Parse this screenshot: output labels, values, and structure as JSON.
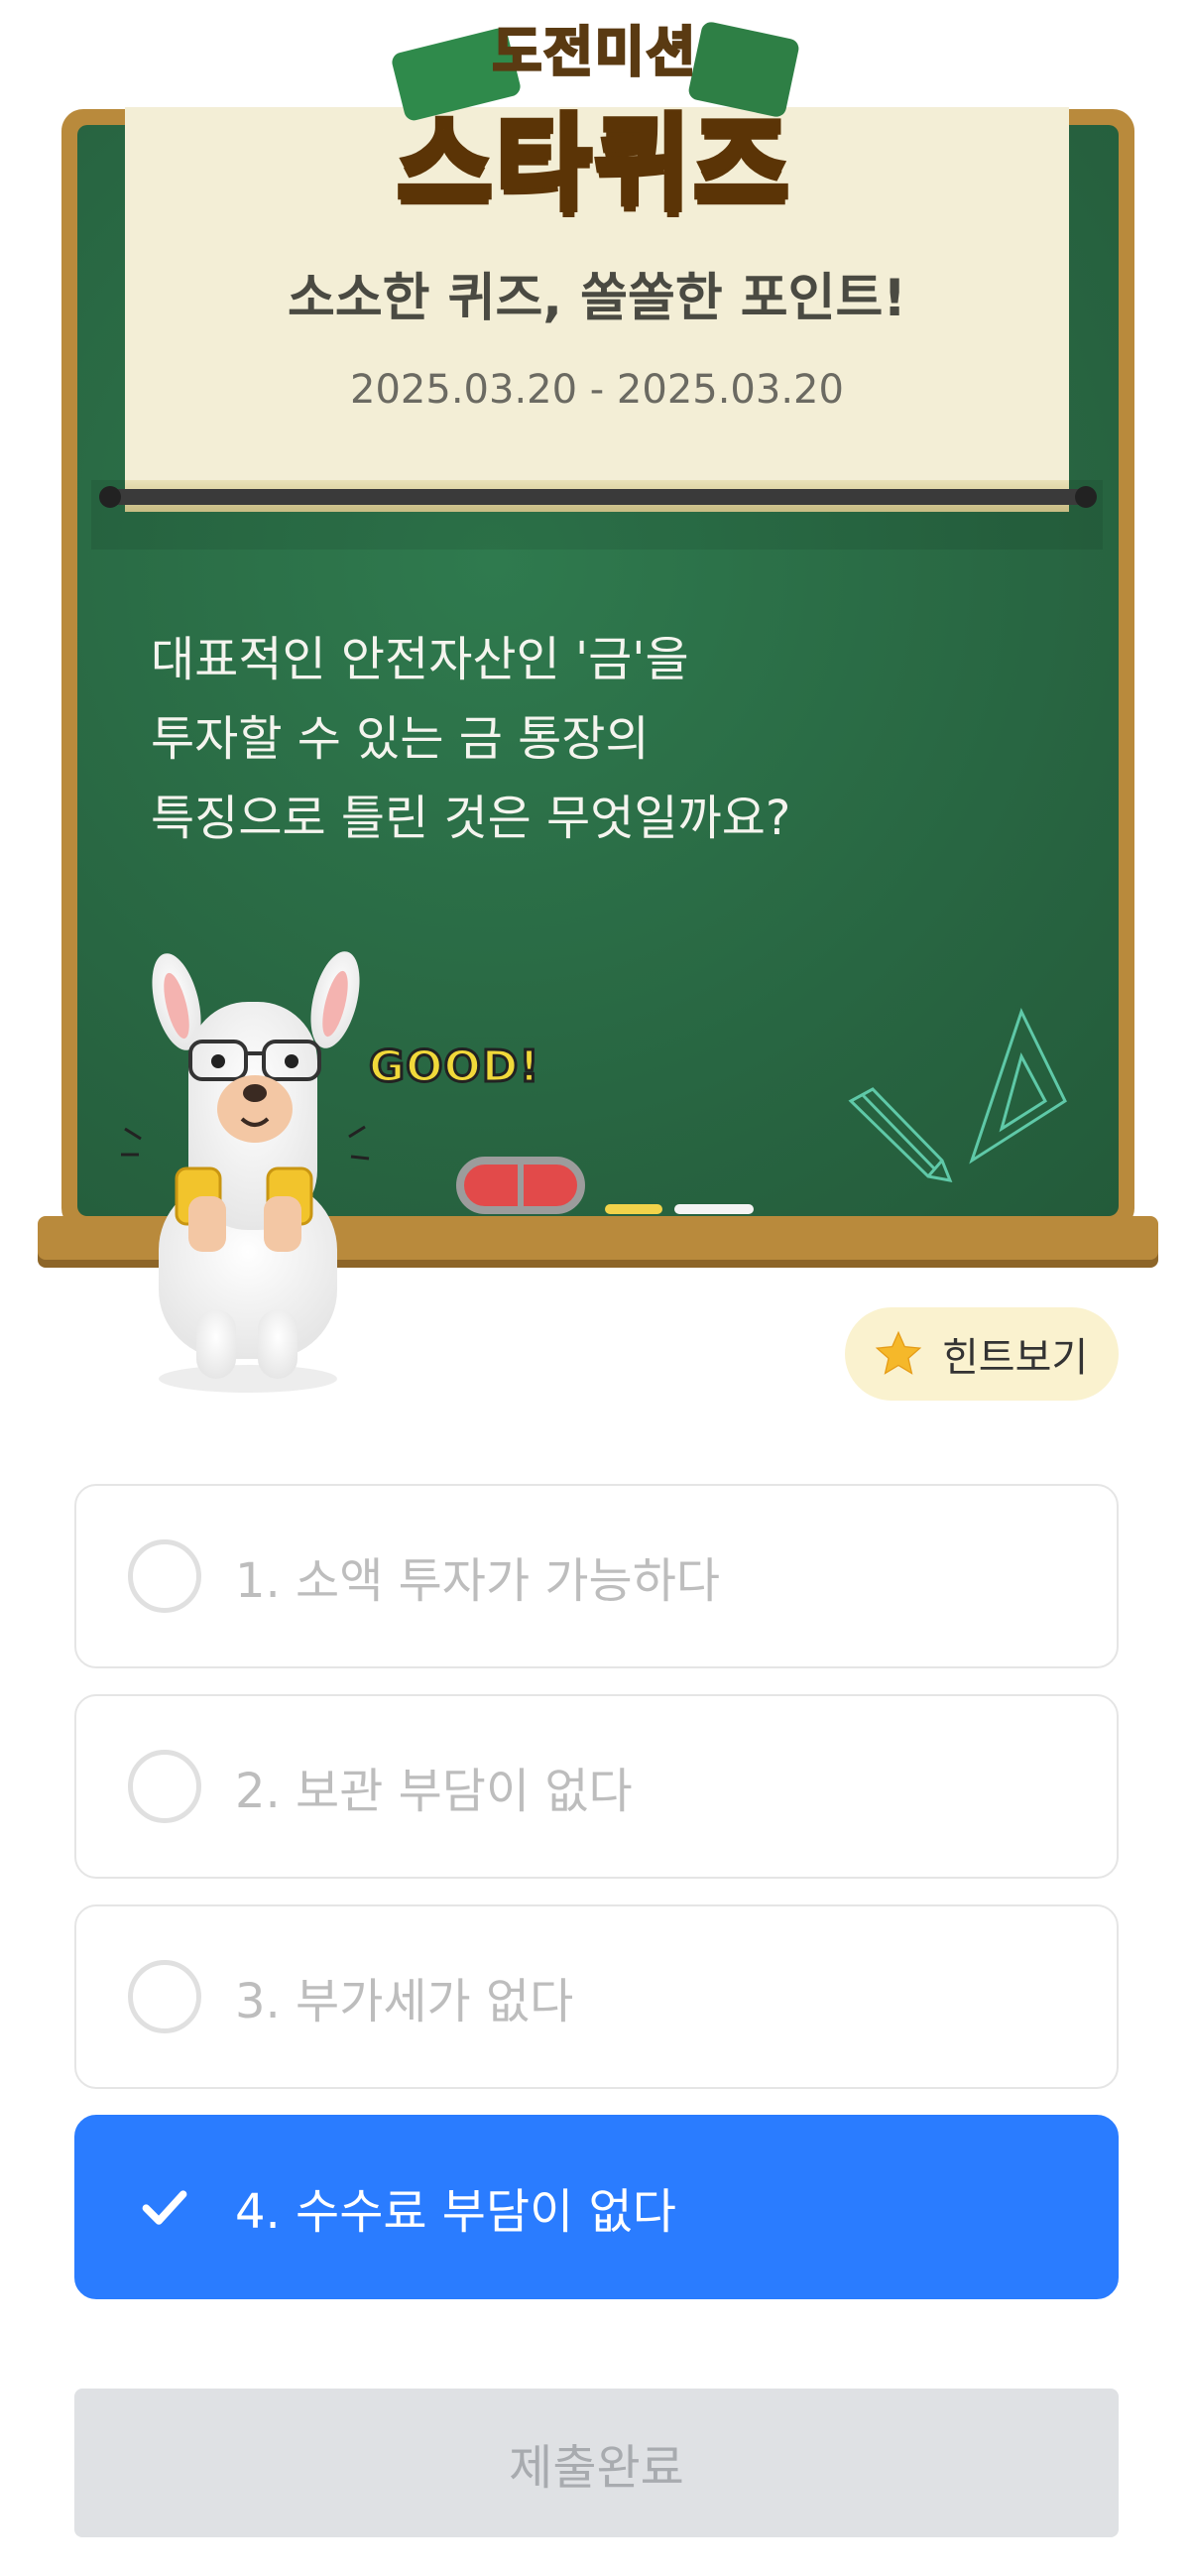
{
  "logo": {
    "top_text": "도전미션",
    "main_text": "스타퀴즈"
  },
  "header": {
    "title": "소소한 퀴즈, 쏠쏠한 포인트!",
    "date_range": "2025.03.20 - 2025.03.20"
  },
  "question": {
    "lines": [
      "대표적인 안전자산인 '금'을",
      "투자할 수 있는 금 통장의",
      "특징으로 틀린 것은 무엇일까요?"
    ]
  },
  "board": {
    "good_text": "GOOD!"
  },
  "hint": {
    "label": "힌트보기"
  },
  "options": [
    {
      "label": "1. 소액 투자가 가능하다",
      "selected": false
    },
    {
      "label": "2. 보관 부담이 없다",
      "selected": false
    },
    {
      "label": "3. 부가세가 없다",
      "selected": false
    },
    {
      "label": "4. 수수료 부담이 없다",
      "selected": true
    }
  ],
  "submit": {
    "label": "제출완료"
  },
  "colors": {
    "board_green": "#2a6a44",
    "board_frame": "#b98a3c",
    "selected_blue": "#2a7cff",
    "hint_bg": "#faf2cf",
    "star": "#f5b82a"
  }
}
